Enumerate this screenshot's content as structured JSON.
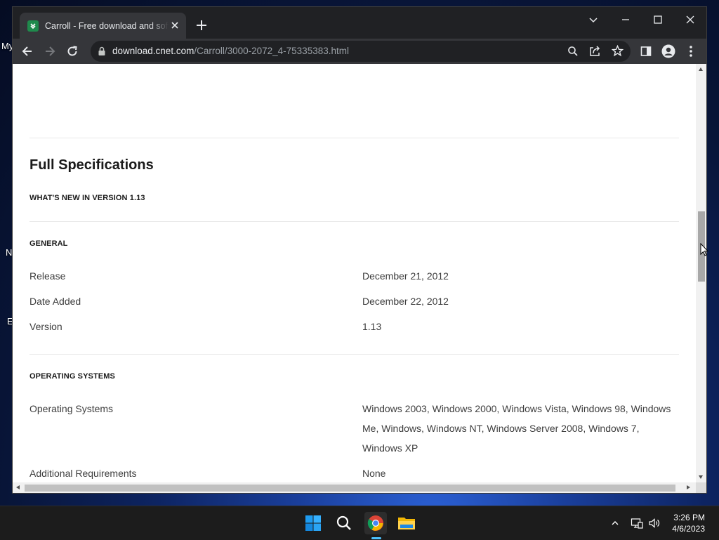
{
  "desktop": {
    "labels": [
      "My",
      "N",
      "E"
    ]
  },
  "browser": {
    "tab": {
      "title": "Carroll - Free download and software",
      "favicon": "cnet-download-favicon"
    },
    "address": {
      "host": "download.cnet.com",
      "path": "/Carroll/3000-2072_4-75335383.html"
    }
  },
  "page": {
    "heading": "Full Specifications",
    "whats_new": "WHAT'S NEW IN VERSION 1.13",
    "general": {
      "title": "GENERAL",
      "rows": [
        {
          "label": "Release",
          "value": "December 21, 2012"
        },
        {
          "label": "Date Added",
          "value": "December 22, 2012"
        },
        {
          "label": "Version",
          "value": "1.13"
        }
      ]
    },
    "os": {
      "title": "OPERATING SYSTEMS",
      "rows": [
        {
          "label": "Operating Systems",
          "value": "Windows 2003, Windows 2000, Windows Vista, Windows 98, Windows Me, Windows, Windows NT, Windows Server 2008, Windows 7, Windows XP"
        },
        {
          "label": "Additional Requirements",
          "value": "None"
        }
      ]
    }
  },
  "taskbar": {
    "time": "3:26 PM",
    "date": "4/6/2023",
    "accent": "#4cc2ff"
  }
}
